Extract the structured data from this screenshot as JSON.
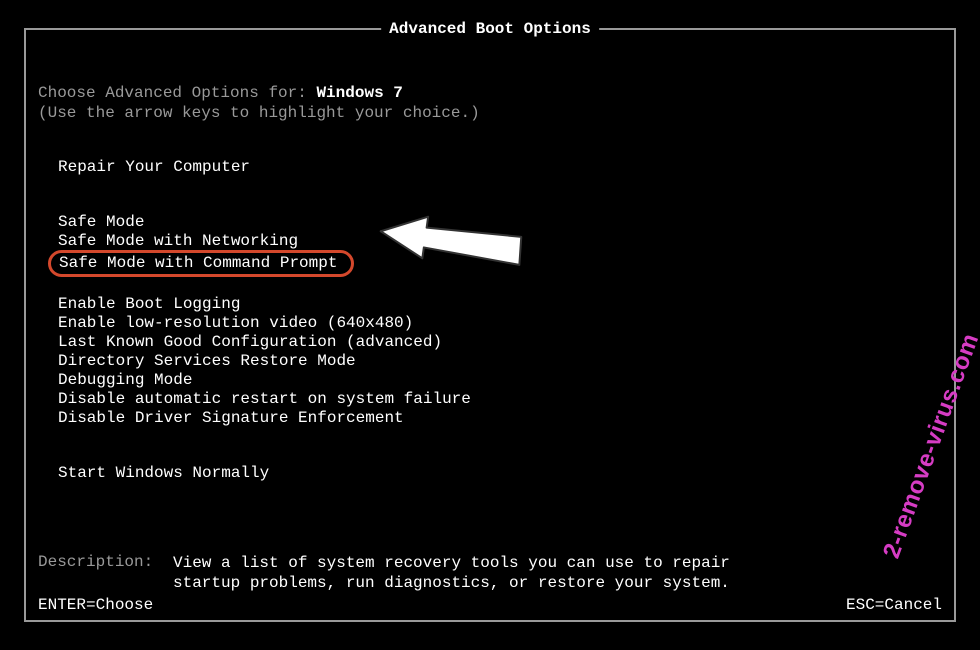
{
  "header": {
    "title": "Advanced Boot Options"
  },
  "choose": {
    "prefix": "Choose Advanced Options for: ",
    "os": "Windows 7",
    "hint": "(Use the arrow keys to highlight your choice.)"
  },
  "menu": {
    "repair": "Repair Your Computer",
    "safe1": "Safe Mode",
    "safe2": "Safe Mode with Networking",
    "safe3": "Safe Mode with Command Prompt",
    "opt1": "Enable Boot Logging",
    "opt2": "Enable low-resolution video (640x480)",
    "opt3": "Last Known Good Configuration (advanced)",
    "opt4": "Directory Services Restore Mode",
    "opt5": "Debugging Mode",
    "opt6": "Disable automatic restart on system failure",
    "opt7": "Disable Driver Signature Enforcement",
    "start": "Start Windows Normally"
  },
  "description": {
    "label": "Description:",
    "text": "View a list of system recovery tools you can use to repair startup problems, run diagnostics, or restore your system."
  },
  "footer": {
    "enter": "ENTER=Choose",
    "esc": "ESC=Cancel"
  },
  "watermark": {
    "text": "2-remove-virus.com"
  }
}
